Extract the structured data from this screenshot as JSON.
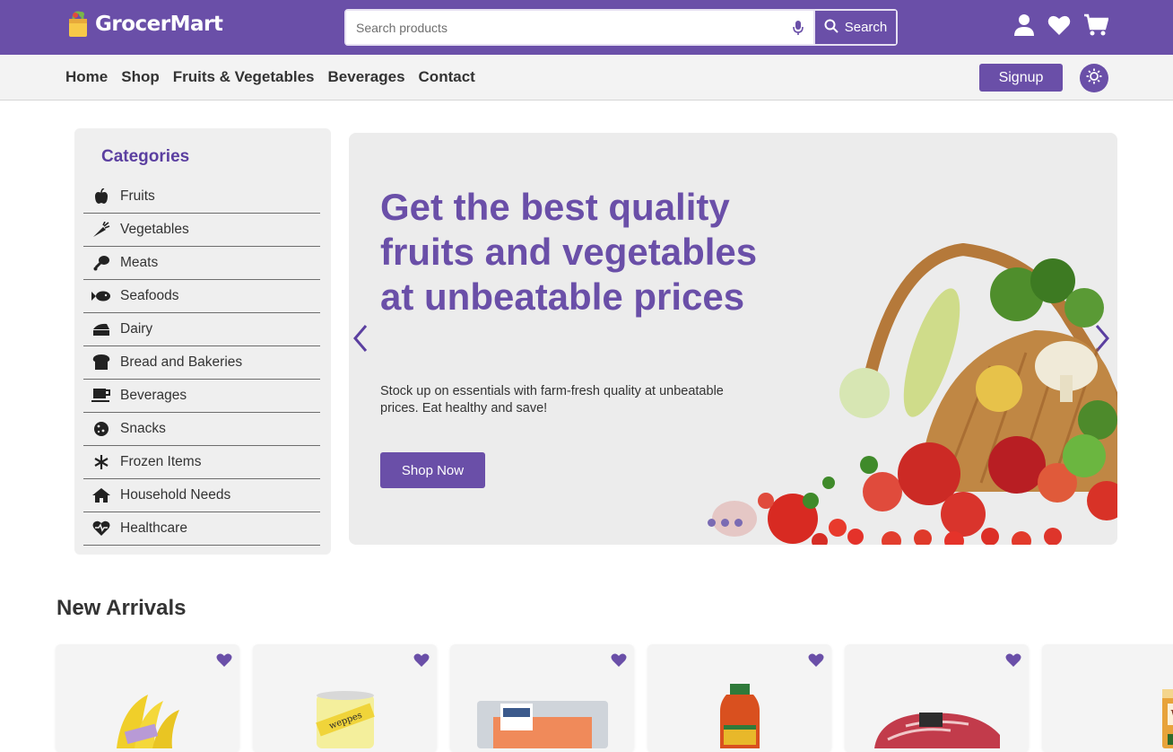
{
  "brand": {
    "name": "GrocerMart"
  },
  "search": {
    "placeholder": "Search products",
    "button_label": "Search"
  },
  "nav": {
    "links": [
      "Home",
      "Shop",
      "Fruits & Vegetables",
      "Beverages",
      "Contact"
    ],
    "signup_label": "Signup"
  },
  "categories": {
    "title": "Categories",
    "items": [
      {
        "label": "Fruits",
        "icon": "apple-icon"
      },
      {
        "label": "Vegetables",
        "icon": "carrot-icon"
      },
      {
        "label": "Meats",
        "icon": "drumstick-icon"
      },
      {
        "label": "Seafoods",
        "icon": "fish-icon"
      },
      {
        "label": "Dairy",
        "icon": "cheese-icon"
      },
      {
        "label": "Bread and Bakeries",
        "icon": "bread-icon"
      },
      {
        "label": "Beverages",
        "icon": "mug-icon"
      },
      {
        "label": "Snacks",
        "icon": "cookie-icon"
      },
      {
        "label": "Frozen Items",
        "icon": "snowflake-icon"
      },
      {
        "label": "Household Needs",
        "icon": "house-icon"
      },
      {
        "label": "Healthcare",
        "icon": "heartbeat-icon"
      }
    ]
  },
  "hero": {
    "title": "Get the best quality fruits and vegetables at unbeatable prices",
    "subtitle": "Stock up on essentials with farm-fresh quality at unbeatable prices. Eat healthy and save!",
    "cta_label": "Shop Now"
  },
  "new_arrivals": {
    "title": "New Arrivals",
    "products": [
      {
        "image": "bananas"
      },
      {
        "image": "schweppes-can"
      },
      {
        "image": "salmon-pack"
      },
      {
        "image": "juice-bottle"
      },
      {
        "image": "steak"
      },
      {
        "image": "werthers-candy"
      }
    ]
  },
  "colors": {
    "brand_purple": "#6a4fa8",
    "panel_grey": "#efefef"
  }
}
